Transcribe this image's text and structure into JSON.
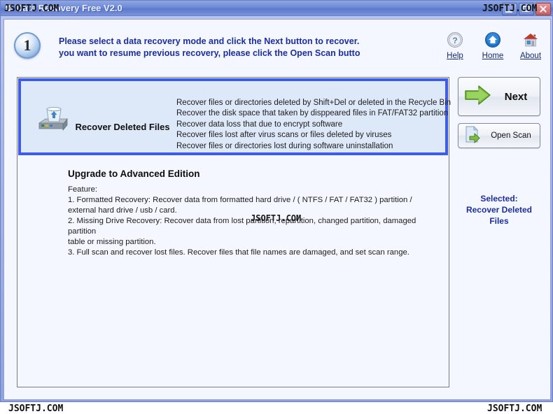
{
  "window": {
    "title": "Data Recovery Free V2.0",
    "app_icon": "disk-icon",
    "controls": {
      "minimize": "Minimize",
      "maximize": "Maximize",
      "close": "Close"
    }
  },
  "header": {
    "step_number": "1",
    "hint_line1": "Please select a data recovery mode and click the Next button to recover.",
    "hint_line2": "you want to resume previous recovery, please click the Open Scan butto",
    "icons": [
      {
        "name": "help-icon",
        "label": "Help"
      },
      {
        "name": "home-icon",
        "label": "Home"
      },
      {
        "name": "about-icon",
        "label": "About"
      }
    ]
  },
  "mode_card": {
    "icon": "recycle-bin-drive-icon",
    "title": "Recover Deleted Files",
    "features": [
      "Recover files or directories deleted by Shift+Del or deleted in the Recycle Bin",
      "Recover the disk space that taken by disppeared files in FAT/FAT32 partition",
      "Recover data loss that due to encrypt software",
      "Recover files lost after virus scans or files deleted by viruses",
      "Recover files or directories lost during software uninstallation"
    ]
  },
  "upgrade": {
    "heading": "Upgrade to Advanced Edition",
    "lines": [
      "Feature:",
      "1. Formatted Recovery: Recover data from formatted hard drive / ( NTFS / FAT / FAT32  ) partition /",
      "external hard drive / usb / card.",
      "2. Missing Drive Recovery: Recover data from lost partition, repartition, changed partition, damaged partition",
      "table or missing partition.",
      "3. Full scan and recover lost files. Recover files that file names are damaged, and set scan range."
    ]
  },
  "rail": {
    "next_label": "Next",
    "next_icon": "green-arrow-right-icon",
    "open_scan_label": "Open Scan",
    "open_scan_icon": "file-with-green-arrow-icon",
    "selected_label": "Selected:",
    "selected_value_line1": "Recover Deleted",
    "selected_value_line2": "Files"
  },
  "watermarks": {
    "title_left": "JSOFTJ.COM",
    "title_right": "JSOFTJ.COM",
    "middle": "JSOFTJ.COM",
    "bottom_left": "JSOFTJ.COM",
    "bottom_right": "JSOFTJ.COM"
  },
  "colors": {
    "accent_blue": "#3d5ce8",
    "title_text": "#1b2ea0",
    "card_fill": "#dde9f9",
    "client_bg": "#f4f7ff",
    "frame": "#8fa2dd"
  }
}
